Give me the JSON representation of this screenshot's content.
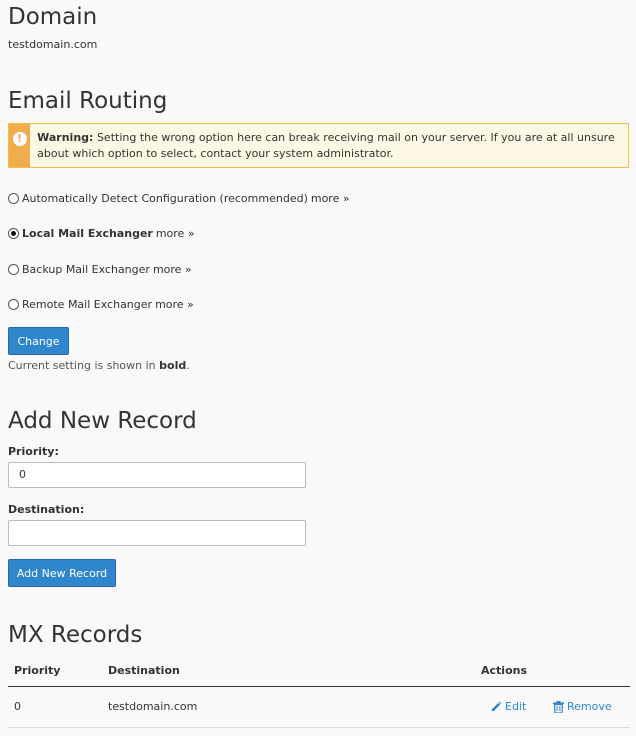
{
  "domain": {
    "heading": "Domain",
    "value": "testdomain.com"
  },
  "email_routing": {
    "heading": "Email Routing",
    "warning": {
      "label": "Warning:",
      "text": "Setting the wrong option here can break receiving mail on your server. If you are at all unsure about which option to select, contact your system administrator."
    },
    "options": [
      {
        "label": "Automatically Detect Configuration (recommended)",
        "more": "more »",
        "selected": false
      },
      {
        "label": "Local Mail Exchanger",
        "more": "more »",
        "selected": true
      },
      {
        "label": "Backup Mail Exchanger",
        "more": "more »",
        "selected": false
      },
      {
        "label": "Remote Mail Exchanger",
        "more": "more »",
        "selected": false
      }
    ],
    "change_button": "Change",
    "note_prefix": "Current setting is shown in",
    "note_bold": "bold",
    "note_suffix": "."
  },
  "add_record": {
    "heading": "Add New Record",
    "priority_label": "Priority:",
    "priority_value": "0",
    "destination_label": "Destination:",
    "destination_value": "",
    "button": "Add New Record"
  },
  "mx_records": {
    "heading": "MX Records",
    "columns": [
      "Priority",
      "Destination",
      "Actions"
    ],
    "rows": [
      {
        "priority": "0",
        "destination": "testdomain.com",
        "edit": "Edit",
        "remove": "Remove"
      }
    ]
  },
  "colors": {
    "accent": "#2f86cc",
    "warning": "#f0ad4e",
    "background": "#f9f9f9"
  },
  "icons": [
    "exclamation-icon",
    "pencil-icon",
    "trash-icon"
  ]
}
